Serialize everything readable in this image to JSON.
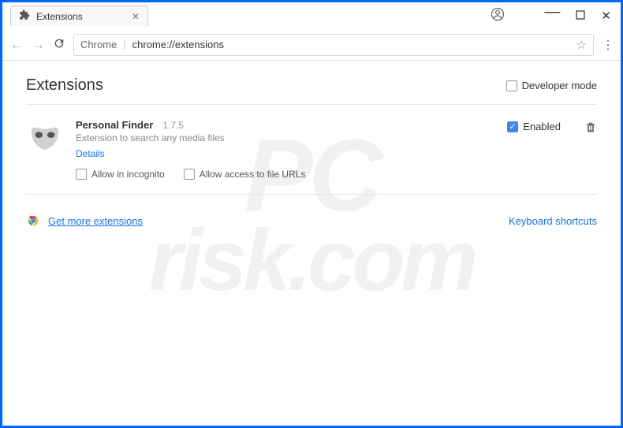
{
  "window": {
    "tab_title": "Extensions",
    "url_scheme": "Chrome",
    "url": "chrome://extensions"
  },
  "page": {
    "title": "Extensions",
    "developer_mode_label": "Developer mode",
    "developer_mode_checked": false
  },
  "extension": {
    "name": "Personal Finder",
    "version": "1.7.5",
    "description": "Extension to search any media files",
    "details_link": "Details",
    "allow_incognito_label": "Allow in incognito",
    "allow_incognito_checked": false,
    "allow_file_urls_label": "Allow access to file URLs",
    "allow_file_urls_checked": false,
    "enabled_label": "Enabled",
    "enabled_checked": true
  },
  "footer": {
    "get_more_label": "Get more extensions",
    "keyboard_shortcuts_label": "Keyboard shortcuts"
  },
  "icons": {
    "puzzle": "puzzle-icon",
    "user": "user-icon",
    "minimize": "minimize-icon",
    "maximize": "maximize-icon",
    "close": "close-icon",
    "back": "back-icon",
    "forward": "forward-icon",
    "reload": "reload-icon",
    "star": "star-icon",
    "menu": "menu-icon",
    "mask": "mask-icon",
    "trash": "trash-icon",
    "chrome-store": "chrome-store-icon"
  }
}
